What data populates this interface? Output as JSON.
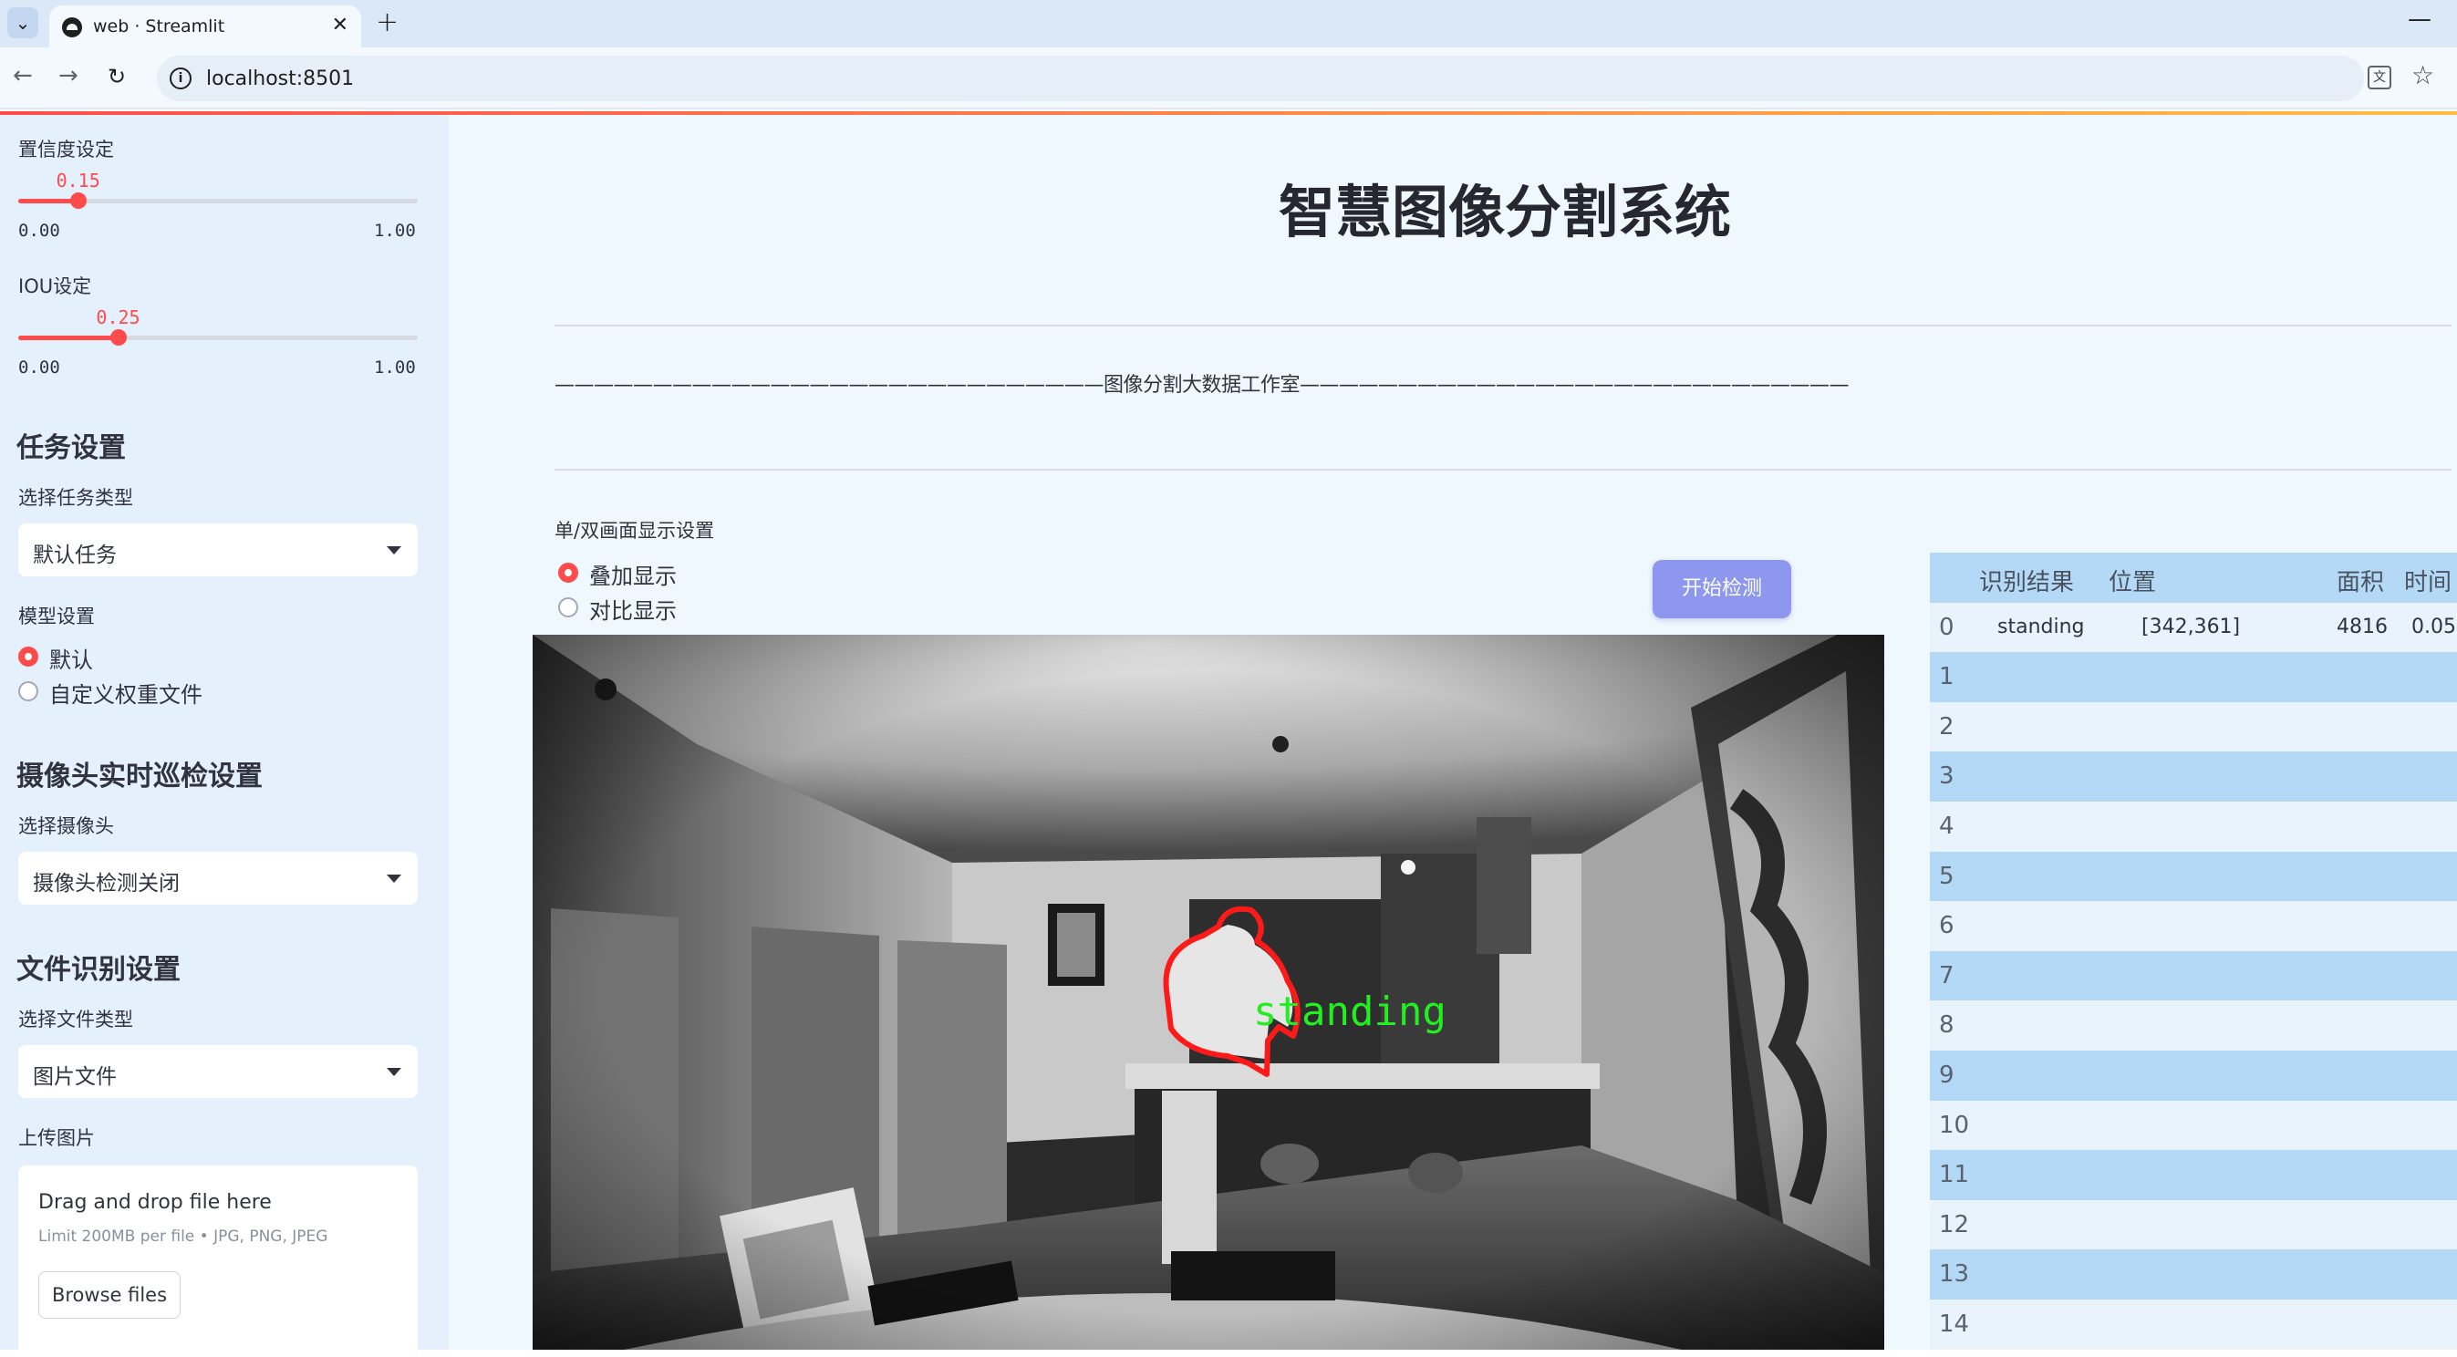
{
  "browser": {
    "tab_title": "web · Streamlit",
    "url": "localhost:8501"
  },
  "sidebar": {
    "confidence": {
      "label": "置信度设定",
      "value": 0.15,
      "value_text": "0.15",
      "min": "0.00",
      "max": "1.00"
    },
    "iou": {
      "label": "IOU设定",
      "value": 0.25,
      "value_text": "0.25",
      "min": "0.00",
      "max": "1.00"
    },
    "task_section": "任务设置",
    "task_type_label": "选择任务类型",
    "task_type_value": "默认任务",
    "model_label": "模型设置",
    "model_options": [
      "默认",
      "自定义权重文件"
    ],
    "model_selected": 0,
    "camera_section": "摄像头实时巡检设置",
    "camera_label": "选择摄像头",
    "camera_value": "摄像头检测关闭",
    "file_section": "文件识别设置",
    "file_type_label": "选择文件类型",
    "file_type_value": "图片文件",
    "upload_label": "上传图片",
    "uploader": {
      "title": "Drag and drop file here",
      "limit": "Limit 200MB per file • JPG, PNG, JPEG",
      "button": "Browse files"
    }
  },
  "main": {
    "title": "智慧图像分割系统",
    "studio_banner": "————————————————————————————图像分割大数据工作室————————————————————————————",
    "display_label": "单/双画面显示设置",
    "display_options": [
      "叠加显示",
      "对比显示"
    ],
    "display_selected": 0,
    "detect_button": "开始检测",
    "detection_label": "standing"
  },
  "results": {
    "columns": [
      "识别结果",
      "位置",
      "面积",
      "时间"
    ],
    "rows": [
      {
        "idx": "0",
        "result": "standing",
        "position": "[342,361]",
        "area": "4816",
        "time": "0.05"
      },
      {
        "idx": "1"
      },
      {
        "idx": "2"
      },
      {
        "idx": "3"
      },
      {
        "idx": "4"
      },
      {
        "idx": "5"
      },
      {
        "idx": "6"
      },
      {
        "idx": "7"
      },
      {
        "idx": "8"
      },
      {
        "idx": "9"
      },
      {
        "idx": "10"
      },
      {
        "idx": "11"
      },
      {
        "idx": "12"
      },
      {
        "idx": "13"
      },
      {
        "idx": "14"
      }
    ]
  }
}
